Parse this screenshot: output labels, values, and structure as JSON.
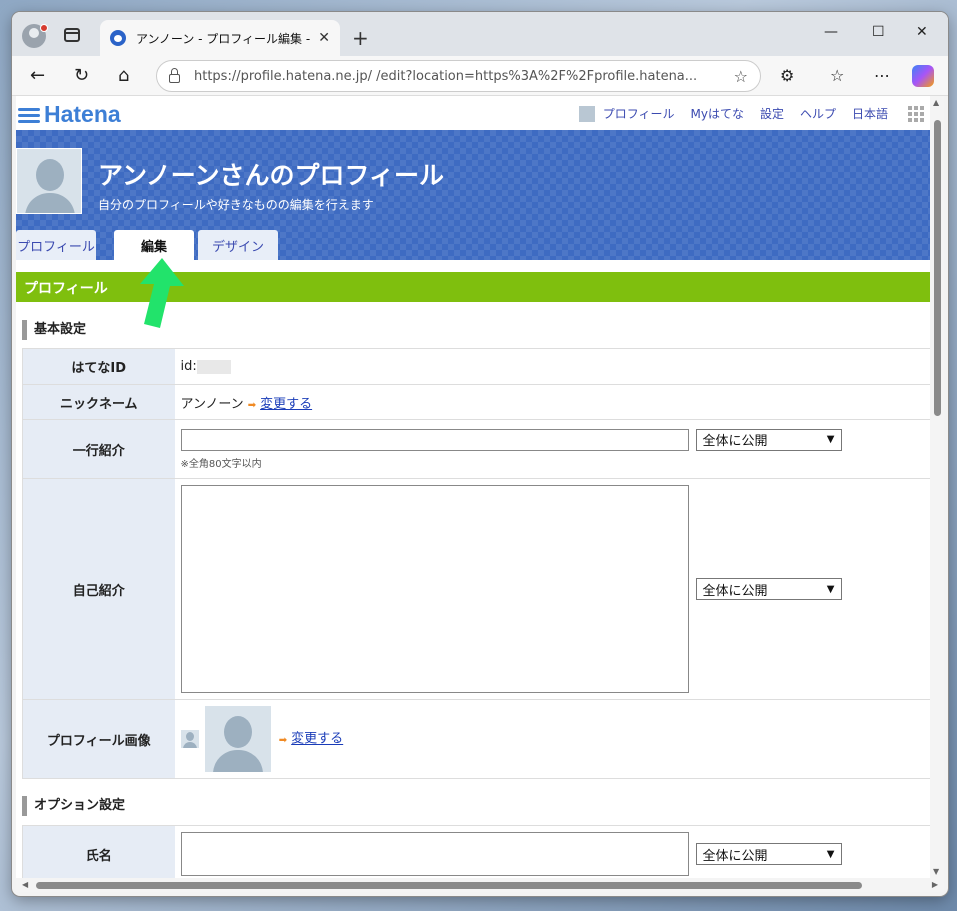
{
  "browser": {
    "tab_title": "アンノーン - プロフィール編集 - はてな",
    "tab_close": "✕",
    "new_tab": "+",
    "url": "https://profile.hatena.ne.jp/        /edit?location=https%3A%2F%2Fprofile.hatena..."
  },
  "hatena_header": {
    "logo": "Hatena",
    "nav": [
      "プロフィール",
      "Myはてな",
      "設定",
      "ヘルプ",
      "日本語"
    ]
  },
  "banner": {
    "title": "アンノーンさんのプロフィール",
    "subtitle": "自分のプロフィールや好きなものの編集を行えます",
    "tabs": [
      "プロフィール",
      "編集",
      "デザイン"
    ]
  },
  "section": {
    "header": "プロフィール",
    "basic": "基本設定",
    "options": "オプション設定"
  },
  "form": {
    "id_label": "はてなID",
    "id_value": "id:",
    "nickname_label": "ニックネーム",
    "nickname_value": "アンノーン",
    "change_link": "変更する",
    "tagline_label": "一行紹介",
    "tagline_note": "※全角80文字以内",
    "intro_label": "自己紹介",
    "image_label": "プロフィール画像",
    "name_label": "氏名",
    "visibility": "全体に公開"
  },
  "colors": {
    "banner": "#3e6bc2",
    "section_bar": "#7fbf0e",
    "arrow": "#22e36b",
    "link": "#1a3cb8"
  }
}
